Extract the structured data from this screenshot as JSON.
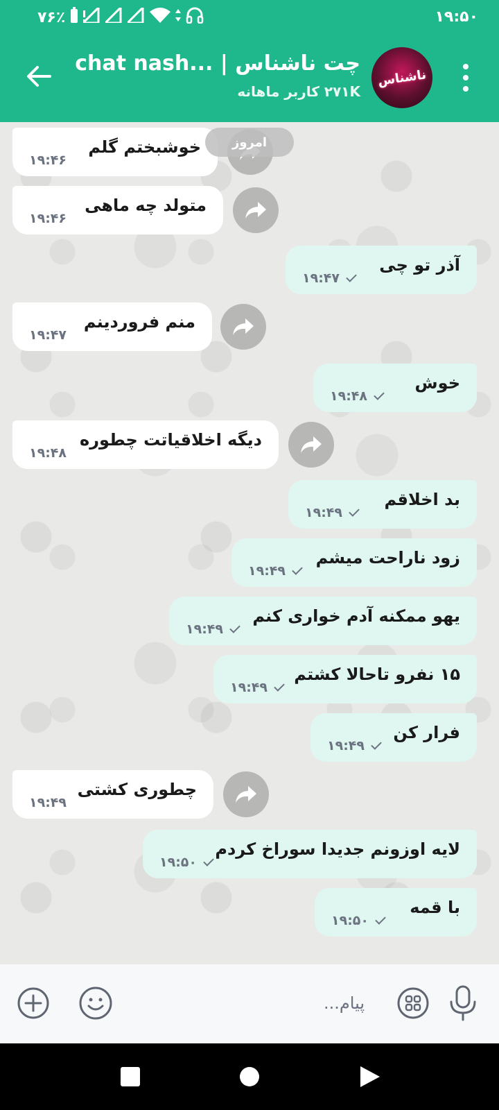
{
  "status_bar": {
    "time": "۱۹:۵۰",
    "battery": "۷۶٪"
  },
  "header": {
    "title": "chat nash... | چت ناشناس",
    "subtitle": "۲۷۱K کاربر ماهانه",
    "avatar_label": "ناشناس"
  },
  "chat": {
    "date_divider": "امروز",
    "messages": [
      {
        "dir": "in",
        "text": "خوشبختم گلم",
        "time": "۱۹:۴۶"
      },
      {
        "dir": "in",
        "text": "متولد چه ماهی",
        "time": "۱۹:۴۶"
      },
      {
        "dir": "out",
        "text": "آذر تو چی",
        "time": "۱۹:۴۷"
      },
      {
        "dir": "in",
        "text": "منم فروردینم",
        "time": "۱۹:۴۷"
      },
      {
        "dir": "out",
        "text": "خوش",
        "time": "۱۹:۴۸"
      },
      {
        "dir": "in",
        "text": "دیگه اخلاقیاتت چطوره",
        "time": "۱۹:۴۸"
      },
      {
        "dir": "out",
        "text": "بد اخلاقم",
        "time": "۱۹:۴۹"
      },
      {
        "dir": "out",
        "text": "زود ناراحت میشم",
        "time": "۱۹:۴۹"
      },
      {
        "dir": "out",
        "text": "یهو ممکنه آدم خواری کنم",
        "time": "۱۹:۴۹"
      },
      {
        "dir": "out",
        "text": "۱۵ نفرو تاحالا کشتم",
        "time": "۱۹:۴۹"
      },
      {
        "dir": "out",
        "text": "فرار کن",
        "time": "۱۹:۴۹"
      },
      {
        "dir": "in",
        "text": "چطوری کشتی",
        "time": "۱۹:۴۹"
      },
      {
        "dir": "out",
        "text": "لایه اوزونم جدیدا سوراخ کردم",
        "time": "۱۹:۵۰"
      },
      {
        "dir": "out",
        "text": "با قمه",
        "time": "۱۹:۵۰"
      }
    ]
  },
  "composer": {
    "placeholder": "پیام..."
  },
  "colors": {
    "accent": "#1fb88c",
    "outgoing_bubble": "#dff7f0",
    "incoming_bubble": "#ffffff"
  }
}
